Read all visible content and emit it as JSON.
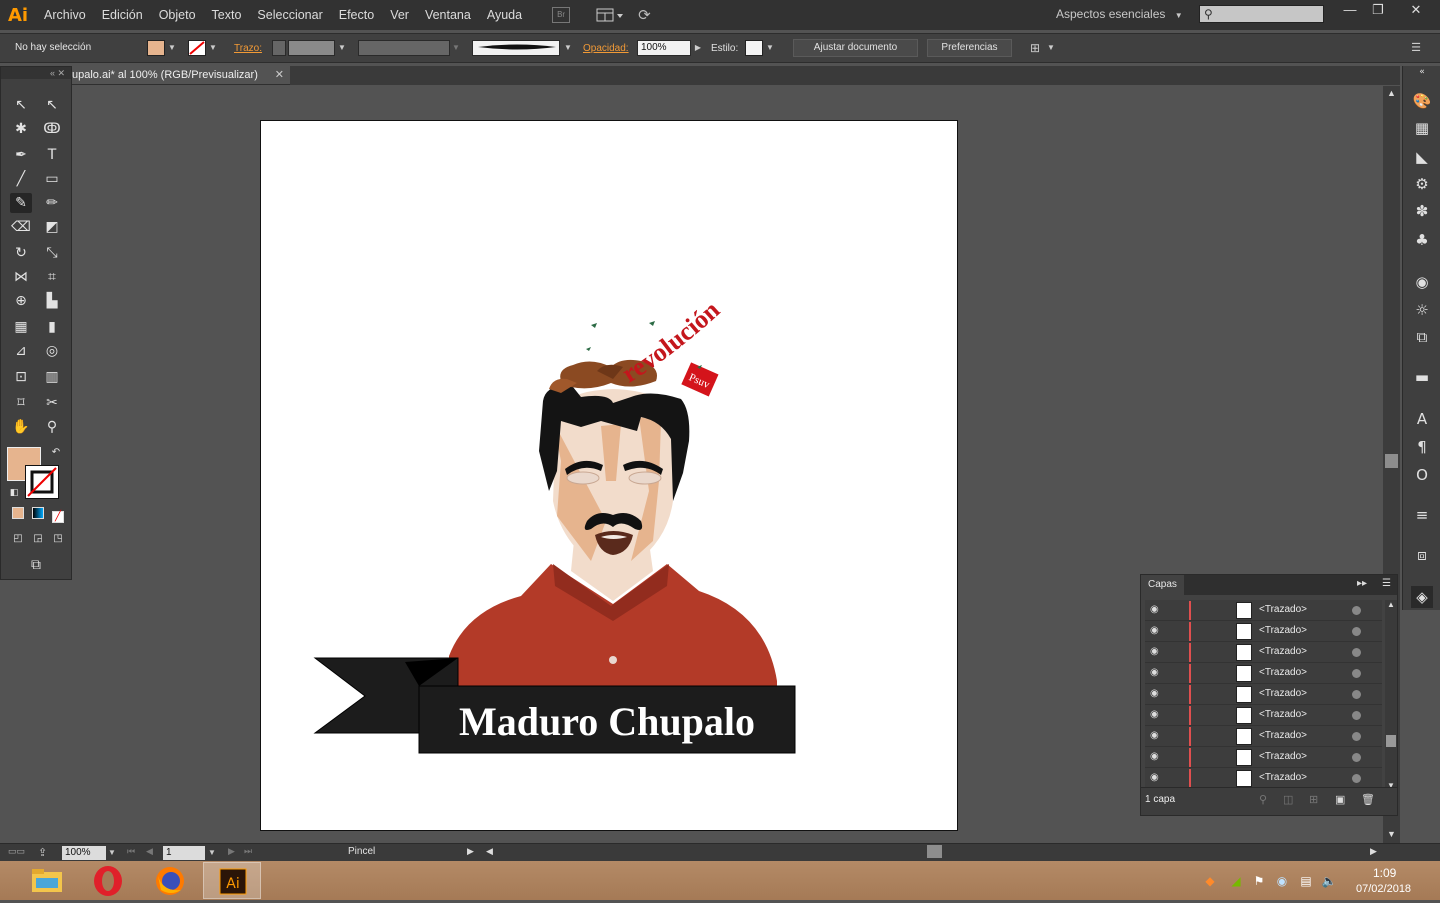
{
  "menubar": {
    "logo": "Ai",
    "items": [
      "Archivo",
      "Edición",
      "Objeto",
      "Texto",
      "Seleccionar",
      "Efecto",
      "Ver",
      "Ventana",
      "Ayuda"
    ],
    "bridge_label": "Br",
    "workspace": "Aspectos esenciales",
    "window_buttons": [
      "—",
      "❐",
      "✕"
    ]
  },
  "controlbar": {
    "selection": "No hay selección",
    "stroke_label": "Trazo:",
    "opacity_label": "Opacidad:",
    "opacity_value": "100%",
    "style_label": "Estilo:",
    "fit_document": "Ajustar documento",
    "preferences": "Preferencias"
  },
  "document": {
    "tab_title": "upalo.ai* al 100% (RGB/Previsualizar)",
    "close": "✕"
  },
  "artwork": {
    "title": "Maduro Chupalo",
    "curved_text": "revolución",
    "flag_text": "Psuv"
  },
  "colors": {
    "fill": "#e6b48e",
    "shirt": "#b33a28",
    "hair": "#141414",
    "skin": "#f2dccb",
    "brown": "#8b4a22",
    "banner": "#1c1c1c",
    "red_text": "#c4161c"
  },
  "layers": {
    "tab": "Capas",
    "rows": [
      "<Trazado>",
      "<Trazado>",
      "<Trazado>",
      "<Trazado>",
      "<Trazado>",
      "<Trazado>",
      "<Trazado>",
      "<Trazado>",
      "<Trazado>"
    ],
    "count": "1 capa"
  },
  "statusbar": {
    "zoom": "100%",
    "artboard_num": "1",
    "tool": "Pincel"
  },
  "taskbar": {
    "time": "1:09",
    "date": "07/02/2018",
    "apps": [
      "file-explorer",
      "opera",
      "firefox",
      "illustrator"
    ]
  }
}
